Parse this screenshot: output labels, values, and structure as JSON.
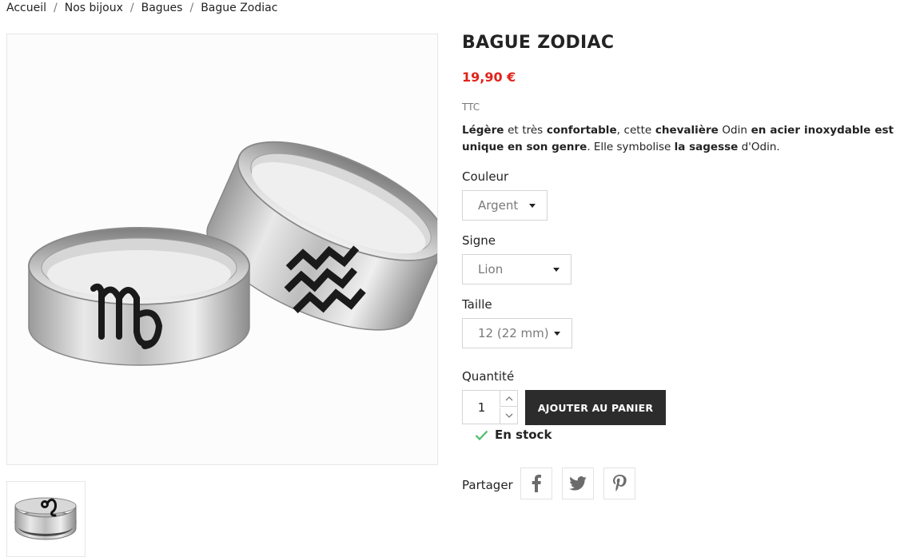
{
  "breadcrumb": {
    "items": [
      "Accueil",
      "Nos bijoux",
      "Bagues",
      "Bague Zodiac"
    ],
    "separator": "/"
  },
  "product": {
    "title": "BAGUE ZODIAC",
    "price": "19,90 €",
    "tax_label": "TTC",
    "description": {
      "p1": "Légère",
      "p2": " et très ",
      "p3": "confortable",
      "p4": ", cette ",
      "p5": "chevalière",
      "p6": " Odin ",
      "p7": "en acier inoxydable est unique en son genre",
      "p8": ". Elle symbolise ",
      "p9": "la sagesse",
      "p10": " d'Odin."
    }
  },
  "options": {
    "color": {
      "label": "Couleur",
      "value": "Argent"
    },
    "sign": {
      "label": "Signe",
      "value": "Lion"
    },
    "size": {
      "label": "Taille",
      "value": "12 (22 mm)"
    }
  },
  "quantity": {
    "label": "Quantité",
    "value": "1"
  },
  "add_to_cart": {
    "label": "AJOUTER AU PANIER"
  },
  "stock": {
    "label": "En stock",
    "color": "#4cbb6c"
  },
  "share": {
    "label": "Partager",
    "icons": [
      "facebook-icon",
      "twitter-icon",
      "pinterest-icon"
    ]
  },
  "colors": {
    "price": "#e2231a",
    "button": "#2c2c2c",
    "border": "#d6d4d4"
  }
}
